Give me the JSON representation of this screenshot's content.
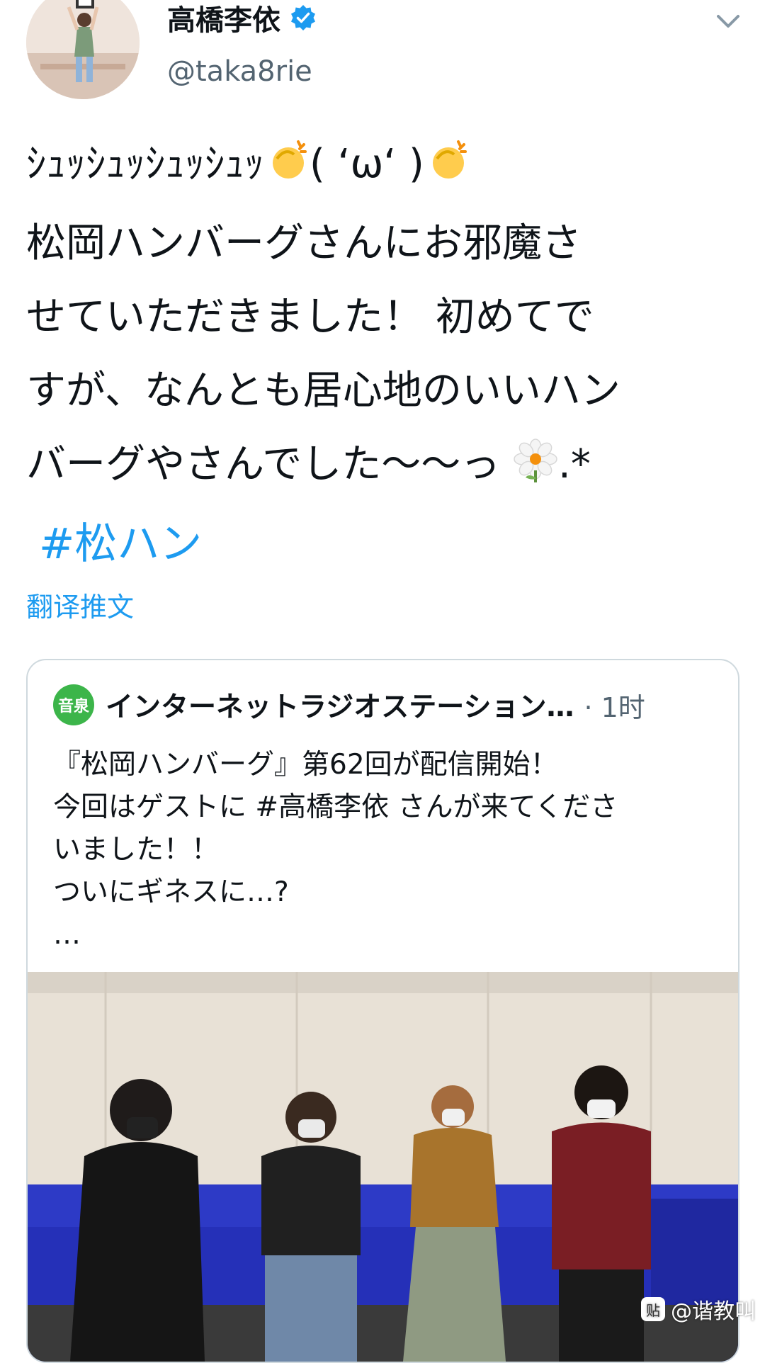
{
  "author": {
    "display_name": "高橋李依",
    "handle": "@taka8rie"
  },
  "tweet": {
    "lines": [
      "ｼｭｯｼｭｯｼｭｯｼｭｯ",
      "( ʻωʻ )",
      "松岡ハンバーグさんにお邪魔さ",
      "せていただきました！ 初めてで",
      "すが、なんとも居心地のいいハン",
      "バーグやさんでした〜〜っ",
      ".*"
    ],
    "hashtag": "#松ハン"
  },
  "translate_label": "翻译推文",
  "quoted_tweet": {
    "account_name": "インターネットラジオステーション…",
    "time": "· 1时",
    "logo_text": "音泉",
    "lines": [
      "『松岡ハンバーグ』第62回が配信開始！",
      "今回はゲストに #高橋李依 さんが来てくださ",
      "いました！！",
      "ついにギネスに…?",
      "…"
    ]
  },
  "watermark": {
    "icon_text": "贴",
    "text": "@谐教叫"
  },
  "colors": {
    "link": "#1d9bf0",
    "verified": "#1d9bf0",
    "secondary_text": "#536471",
    "card_border": "#cfd9de"
  },
  "icons": [
    "verified-badge-icon",
    "chevron-down-icon",
    "clapping-hands-icon",
    "flower-icon"
  ]
}
